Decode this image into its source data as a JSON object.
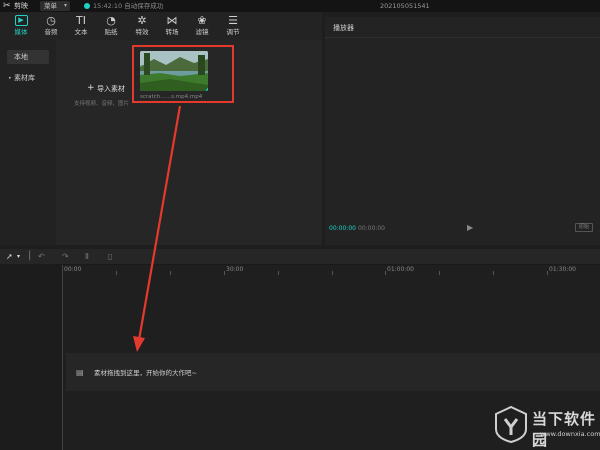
{
  "titlebar": {
    "app_name": "剪映",
    "menu_label": "菜单",
    "save_status": "15:42:10 自动保存成功",
    "project_name": "202105051541"
  },
  "toolbar": {
    "items": [
      {
        "label": "媒体",
        "icon": "media-icon",
        "glyph": "▶"
      },
      {
        "label": "音频",
        "icon": "audio-icon",
        "glyph": "◷"
      },
      {
        "label": "文本",
        "icon": "text-icon",
        "glyph": "TI"
      },
      {
        "label": "贴纸",
        "icon": "sticker-icon",
        "glyph": "◔"
      },
      {
        "label": "特效",
        "icon": "effects-icon",
        "glyph": "✲"
      },
      {
        "label": "转场",
        "icon": "transition-icon",
        "glyph": "⋈"
      },
      {
        "label": "滤镜",
        "icon": "filter-icon",
        "glyph": "❀"
      },
      {
        "label": "调节",
        "icon": "adjust-icon",
        "glyph": "☰"
      }
    ]
  },
  "media": {
    "sidebar": [
      "本地",
      "素材库"
    ],
    "import_label": "导入素材",
    "import_hint": "支持视频、音频、图片",
    "clip_name": "scratch……s.mp4.mp4"
  },
  "player": {
    "title": "播放器",
    "timecode_current": "00:00:00",
    "timecode_duration": "00:00:00",
    "ratio_label": "原始"
  },
  "timeline": {
    "ruler": [
      "00:00",
      "30:00",
      "01:00:00",
      "01:30:00"
    ],
    "track_hint": "素材拖拽到这里，开始你的大作吧~"
  },
  "watermark": {
    "title": "当下软件园",
    "url": "www.downxia.com"
  },
  "colors": {
    "accent": "#1fd3c6",
    "annotation": "#e43a2e"
  }
}
